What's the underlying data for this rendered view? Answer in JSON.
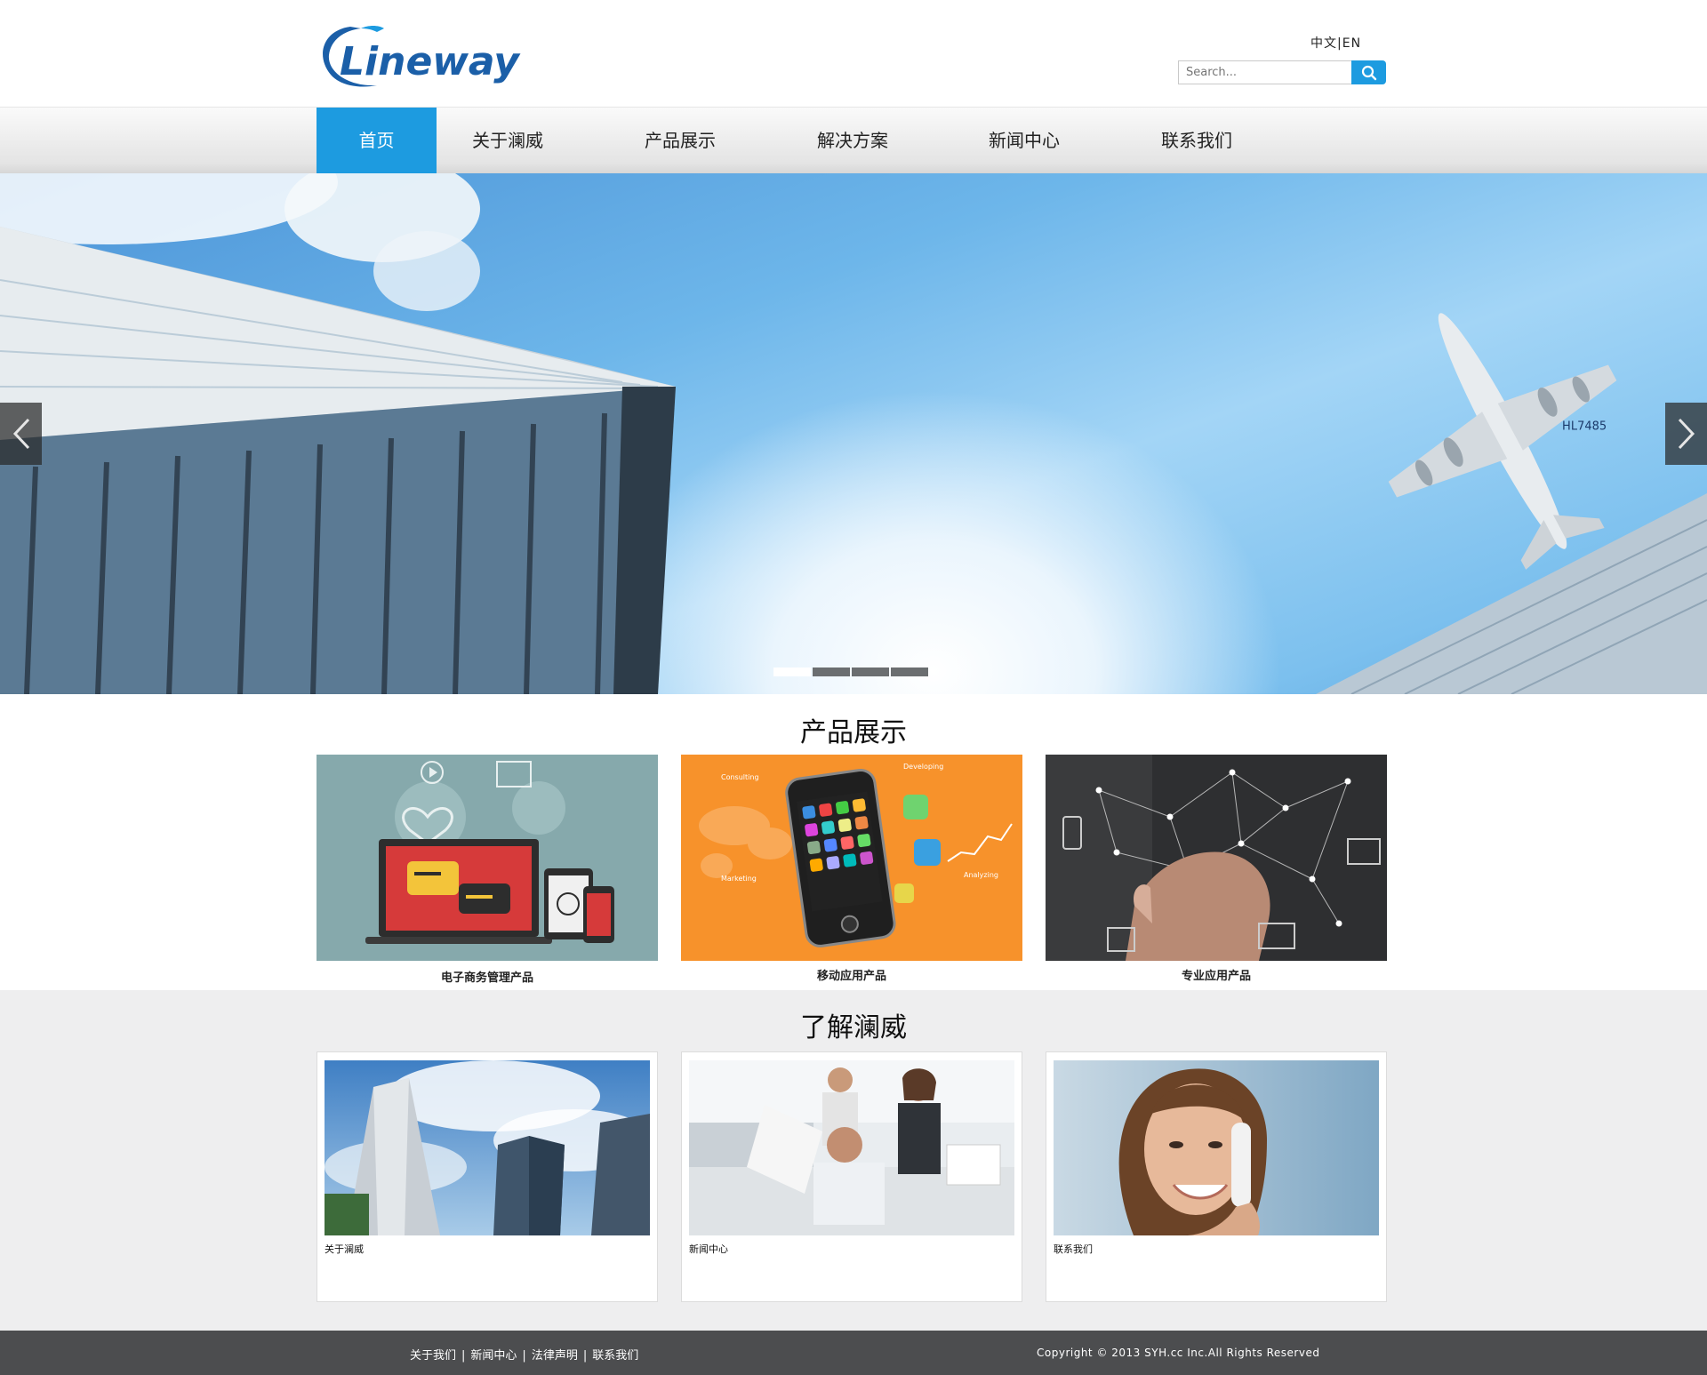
{
  "brand": {
    "logo_text": "Lineway",
    "accent": "#1d9be0",
    "logo_blue": "#1b5fa8"
  },
  "header": {
    "lang_cn": "中文",
    "lang_sep": "|",
    "lang_en": "EN",
    "search_placeholder": "Search...",
    "search_icon": "magnifier-icon"
  },
  "nav": {
    "items": [
      {
        "label": "首页",
        "active": true
      },
      {
        "label": "关于澜威",
        "active": false
      },
      {
        "label": "产品展示",
        "active": false
      },
      {
        "label": "解决方案",
        "active": false
      },
      {
        "label": "新闻中心",
        "active": false
      },
      {
        "label": "联系我们",
        "active": false
      }
    ]
  },
  "banner": {
    "prev_icon": "chevron-left-icon",
    "next_icon": "chevron-right-icon",
    "plane_tail_text": "HL7485",
    "slides_count": 4,
    "active_slide": 1
  },
  "products": {
    "title": "产品展示",
    "items": [
      {
        "label": "电子商务管理产品",
        "image": "ecommerce-illustration"
      },
      {
        "label": "移动应用产品",
        "image": "smartphone-apps-illustration"
      },
      {
        "label": "专业应用产品",
        "image": "network-touch-illustration"
      }
    ],
    "phone_labels": {
      "consulting": "Consulting",
      "developing": "Developing",
      "marketing": "Marketing",
      "analyzing": "Analyzing"
    }
  },
  "about": {
    "title": "了解澜威",
    "cards": [
      {
        "caption": "关于澜威",
        "image": "skyscrapers-photo"
      },
      {
        "caption": "新闻中心",
        "image": "office-team-photo"
      },
      {
        "caption": "联系我们",
        "image": "phone-woman-photo"
      }
    ]
  },
  "footer": {
    "links": [
      "关于我们",
      "新闻中心",
      "法律声明",
      "联系我们"
    ],
    "separator": "|",
    "copyright": "Copyright © 2013 SYH.cc Inc.All Rights Reserved"
  }
}
